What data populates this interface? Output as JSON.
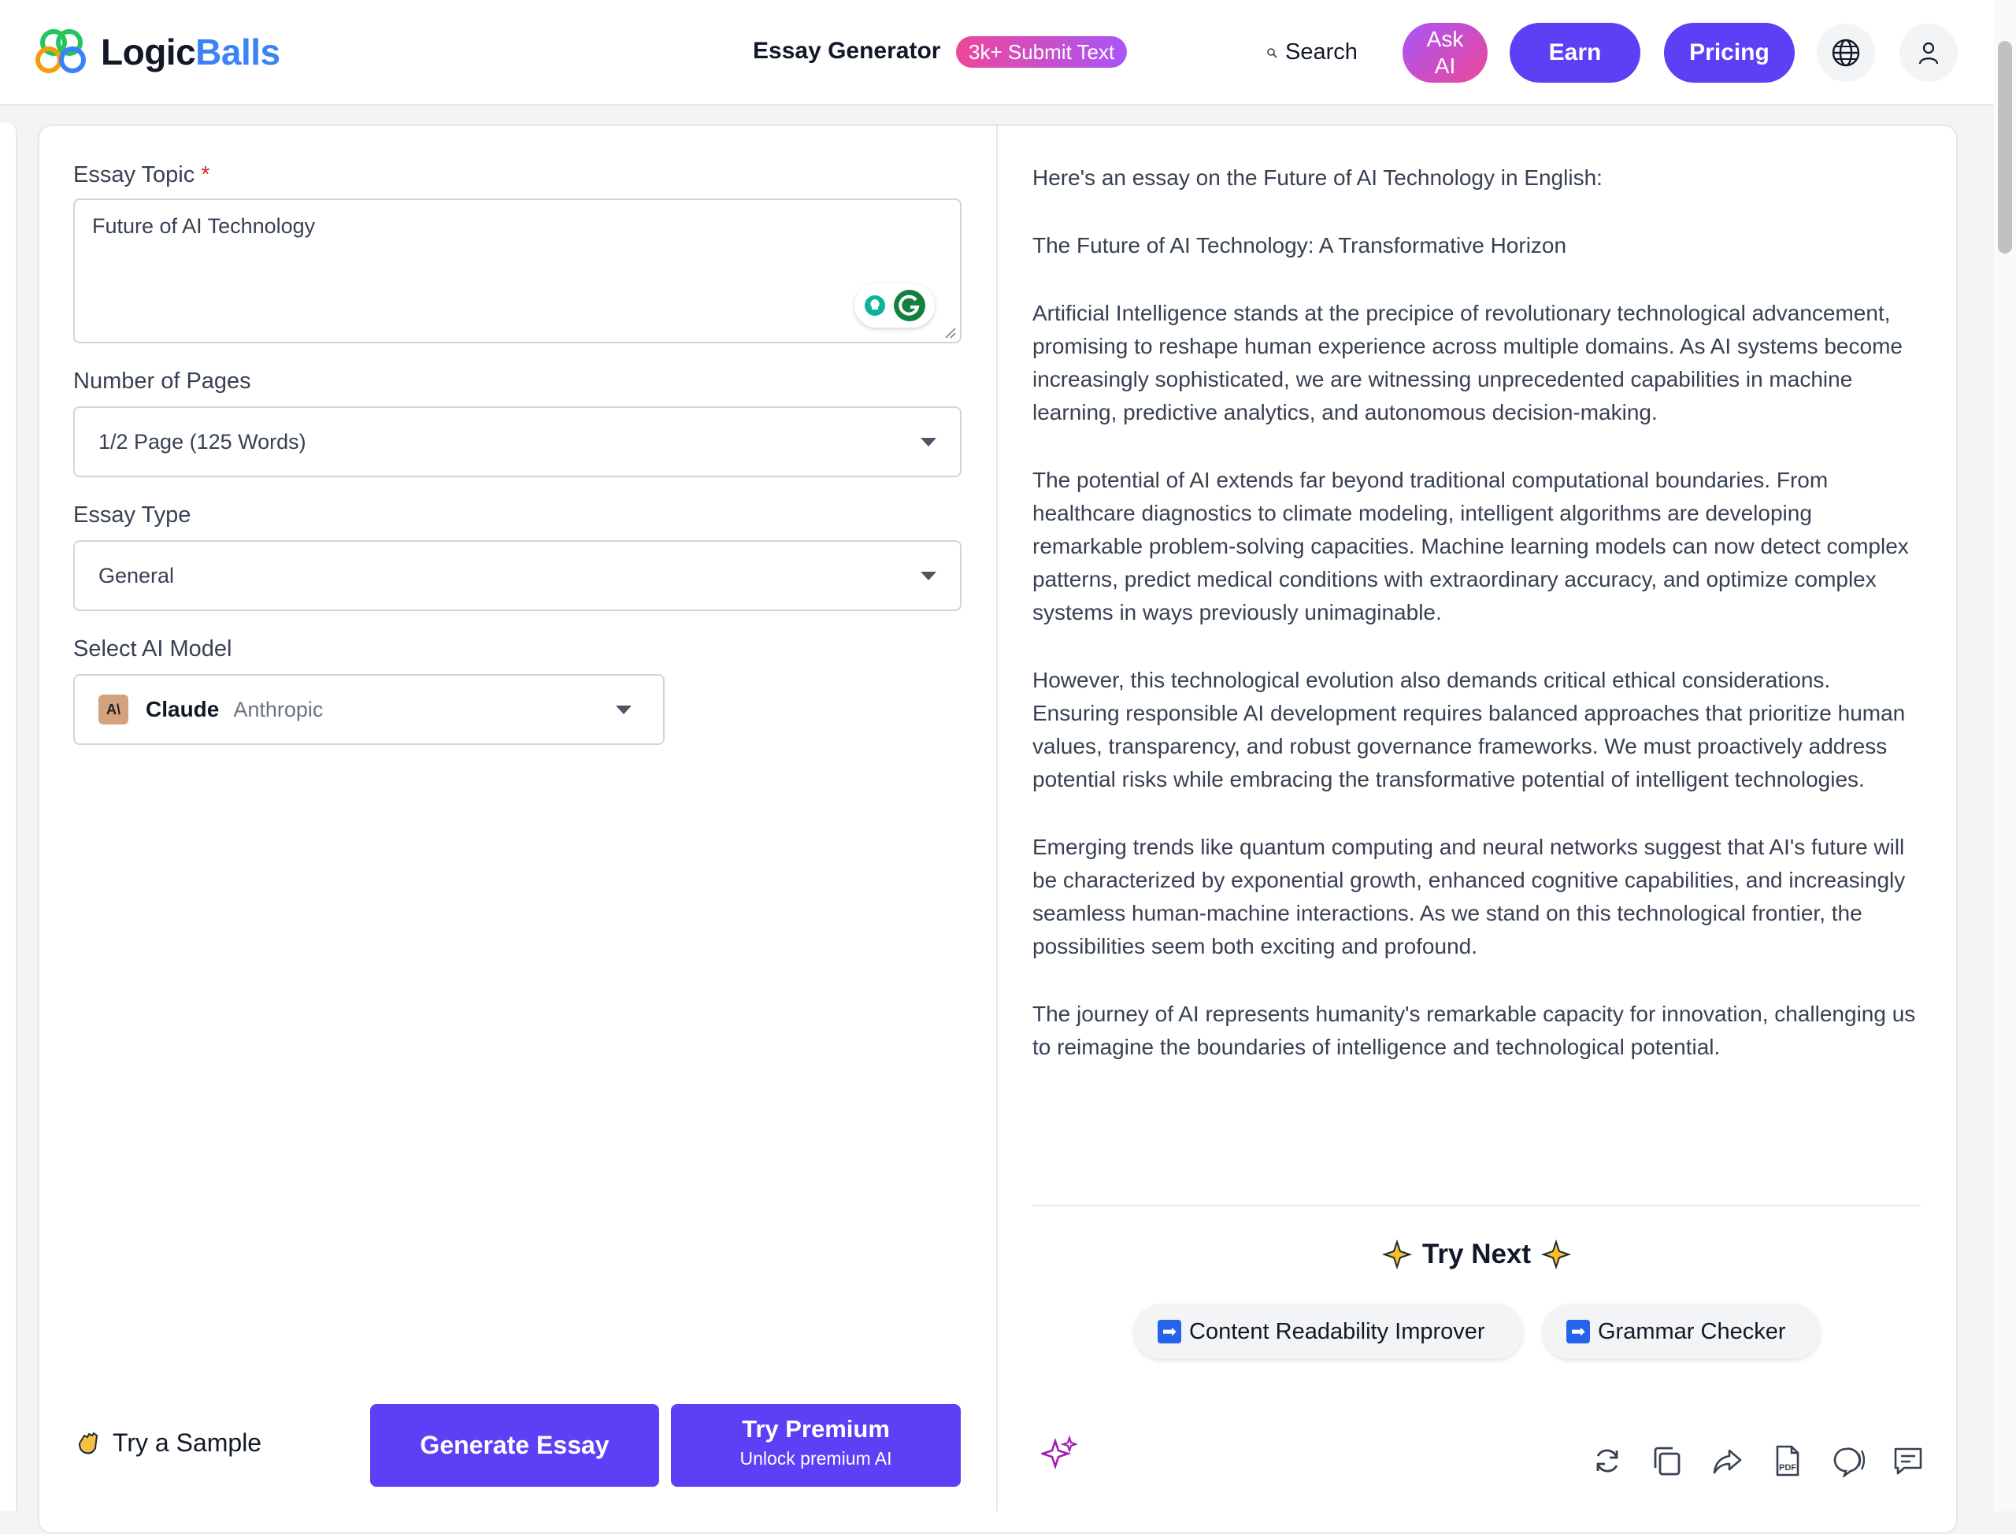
{
  "header": {
    "brand_prefix": "Logic",
    "brand_suffix": "Balls",
    "page_title": "Essay Generator",
    "badge": "3k+ Submit Text",
    "search_label": "Search",
    "ask_ai_line1": "Ask",
    "ask_ai_line2": "AI",
    "earn_label": "Earn",
    "pricing_label": "Pricing"
  },
  "form": {
    "topic_label": "Essay Topic",
    "topic_required": "*",
    "topic_value": "Future of AI Technology",
    "pages_label": "Number of Pages",
    "pages_value": "1/2 Page (125 Words)",
    "type_label": "Essay Type",
    "type_value": "General",
    "model_label": "Select AI Model",
    "model_logo": "A\\",
    "model_name": "Claude",
    "model_vendor": "Anthropic",
    "sample_label": "Try a Sample",
    "generate_label": "Generate Essay",
    "premium_label": "Try Premium",
    "premium_sub": "Unlock premium AI"
  },
  "output": {
    "paragraphs": [
      "Here's an essay on the Future of AI Technology in English:",
      "The Future of AI Technology: A Transformative Horizon",
      "Artificial Intelligence stands at the precipice of revolutionary technological advancement, promising to reshape human experience across multiple domains. As AI systems become increasingly sophisticated, we are witnessing unprecedented capabilities in machine learning, predictive analytics, and autonomous decision-making.",
      "The potential of AI extends far beyond traditional computational boundaries. From healthcare diagnostics to climate modeling, intelligent algorithms are developing remarkable problem-solving capacities. Machine learning models can now detect complex patterns, predict medical conditions with extraordinary accuracy, and optimize complex systems in ways previously unimaginable.",
      "However, this technological evolution also demands critical ethical considerations. Ensuring responsible AI development requires balanced approaches that prioritize human values, transparency, and robust governance frameworks. We must proactively address potential risks while embracing the transformative potential of intelligent technologies.",
      "Emerging trends like quantum computing and neural networks suggest that AI's future will be characterized by exponential growth, enhanced cognitive capabilities, and increasingly seamless human-machine interactions. As we stand on this technological frontier, the possibilities seem both exciting and profound.",
      "The journey of AI represents humanity's remarkable capacity for innovation, challenging us to reimagine the boundaries of intelligence and technological potential."
    ],
    "try_next_label": "Try Next",
    "next_tools": [
      "Content Readability Improver",
      "Grammar Checker"
    ],
    "arrow_glyph": "➡"
  },
  "icons": [
    "logo-icon",
    "search-icon",
    "globe-icon",
    "user-icon",
    "grammarly-icon",
    "hand-icon",
    "sparkle-icon",
    "refresh-icon",
    "copy-icon",
    "share-icon",
    "pdf-icon",
    "speech-icon",
    "comment-icon"
  ],
  "colors": {
    "accent": "#5b40f5",
    "brand_blue": "#3b82f6",
    "required": "#dc2626"
  }
}
